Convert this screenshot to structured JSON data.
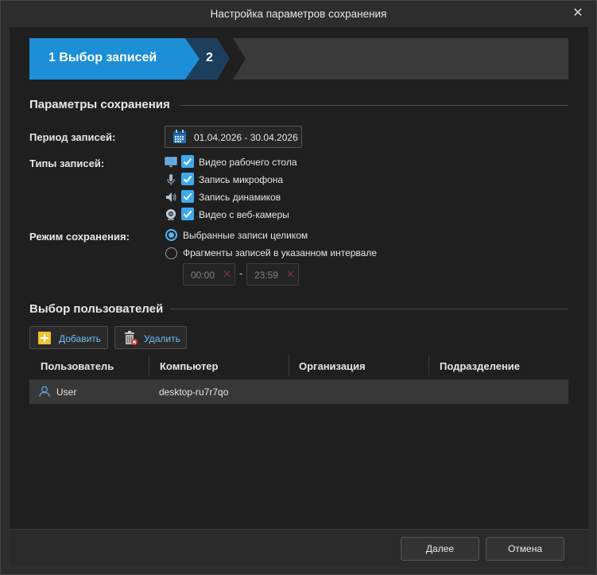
{
  "window": {
    "title": "Настройка параметров сохранения"
  },
  "wizard": {
    "step1_label": "1 Выбор записей",
    "step2_label": "2"
  },
  "save_params": {
    "section_title": "Параметры сохранения",
    "period_label": "Период записей:",
    "period_value": "01.04.2026 - 30.04.2026",
    "types_label": "Типы записей:",
    "types": [
      {
        "label": "Видео рабочего стола",
        "checked": true,
        "icon": "monitor-icon"
      },
      {
        "label": "Запись микрофона",
        "checked": true,
        "icon": "microphone-icon"
      },
      {
        "label": "Запись динамиков",
        "checked": true,
        "icon": "speaker-icon"
      },
      {
        "label": "Видео с веб-камеры",
        "checked": true,
        "icon": "webcam-icon"
      }
    ],
    "mode_label": "Режим сохранения:",
    "modes": [
      {
        "label": "Выбранные записи целиком",
        "selected": true
      },
      {
        "label": "Фрагменты записей в указанном интервале",
        "selected": false
      }
    ],
    "time_from": "00:00",
    "time_to": "23:59",
    "time_separator": "-"
  },
  "users": {
    "section_title": "Выбор пользователей",
    "add_label": "Добавить",
    "delete_label": "Удалить",
    "columns": [
      "Пользователь",
      "Компьютер",
      "Организация",
      "Подразделение"
    ],
    "rows": [
      {
        "user": "User",
        "computer": "desktop-ru7r7qo",
        "organization": "",
        "department": ""
      }
    ]
  },
  "footer": {
    "next_label": "Далее",
    "cancel_label": "Отмена"
  },
  "colors": {
    "accent": "#1c8fd6",
    "step2": "#1c3f5e",
    "checkbox": "#3fa9ee",
    "link": "#6fc0f6"
  }
}
